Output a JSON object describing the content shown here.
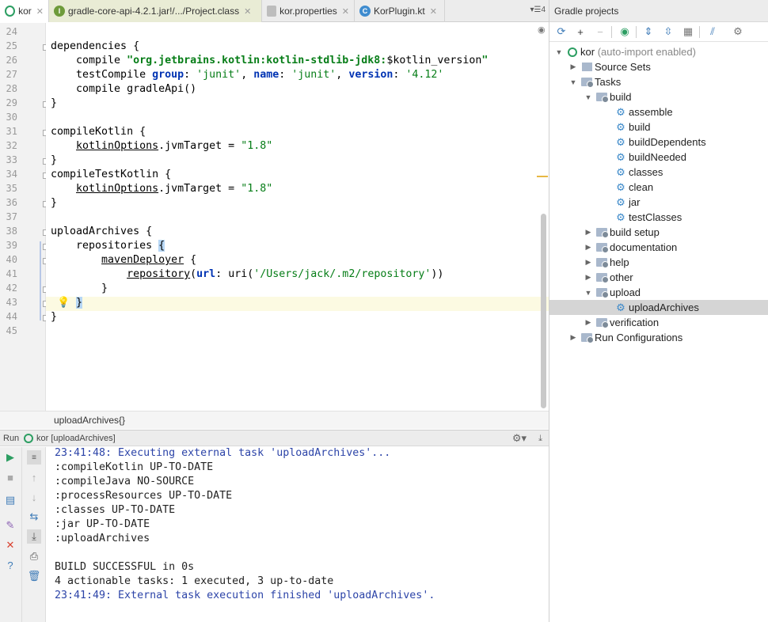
{
  "tabs": [
    {
      "label": "kor",
      "active": true
    },
    {
      "label": "gradle-core-api-4.2.1.jar!/.../Project.class"
    },
    {
      "label": "kor.properties"
    },
    {
      "label": "KorPlugin.kt"
    }
  ],
  "tab_overflow": "4",
  "editor": {
    "line_numbers": [
      "24",
      "25",
      "26",
      "27",
      "28",
      "29",
      "30",
      "31",
      "32",
      "33",
      "34",
      "35",
      "36",
      "37",
      "38",
      "39",
      "40",
      "41",
      "42",
      "43",
      "44",
      "45"
    ],
    "breadcrumb": "uploadArchives{}"
  },
  "run": {
    "title": "Run",
    "config": "kor [uploadArchives]",
    "console": [
      "23:41:48: Executing external task 'uploadArchives'...",
      ":compileKotlin UP-TO-DATE",
      ":compileJava NO-SOURCE",
      ":processResources UP-TO-DATE",
      ":classes UP-TO-DATE",
      ":jar UP-TO-DATE",
      ":uploadArchives",
      "",
      "BUILD SUCCESSFUL in 0s",
      "4 actionable tasks: 1 executed, 3 up-to-date",
      "23:41:49: External task execution finished 'uploadArchives'."
    ]
  },
  "gradle": {
    "title": "Gradle projects",
    "root": "kor",
    "root_note": "(auto-import enabled)",
    "nodes": {
      "source_sets": "Source Sets",
      "tasks": "Tasks",
      "build": "build",
      "assemble": "assemble",
      "build_task": "build",
      "buildDependents": "buildDependents",
      "buildNeeded": "buildNeeded",
      "classes": "classes",
      "clean": "clean",
      "jar": "jar",
      "testClasses": "testClasses",
      "build_setup": "build setup",
      "documentation": "documentation",
      "help": "help",
      "other": "other",
      "upload": "upload",
      "uploadArchives": "uploadArchives",
      "verification": "verification",
      "run_configurations": "Run Configurations"
    }
  }
}
